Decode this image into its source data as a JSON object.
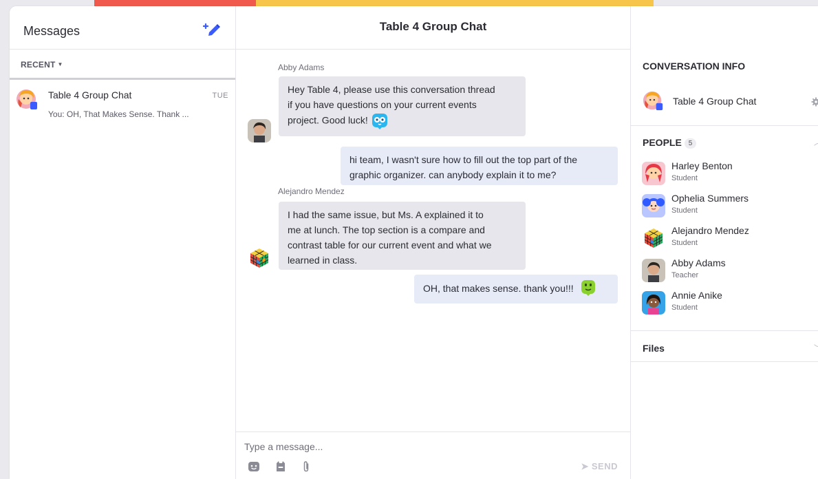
{
  "sidebar": {
    "title": "Messages",
    "recent_label": "RECENT",
    "conversations": [
      {
        "name": "Table 4 Group Chat",
        "day": "TUE",
        "preview": "You: OH, That Makes Sense. Thank ..."
      }
    ]
  },
  "chat": {
    "title": "Table 4 Group Chat",
    "messages": [
      {
        "sender": "Abby Adams",
        "lines": [
          "Hey Table 4, please use this conversation thread",
          "if you have questions on your current events",
          "project. Good luck!"
        ]
      },
      {
        "sender": "",
        "lines": [
          "hi team, I wasn't sure how to fill out the top part of the",
          "graphic organizer. can anybody explain it to me?"
        ]
      },
      {
        "sender": "Alejandro Mendez",
        "lines": [
          "I had the same issue, but Ms. A explained it to",
          "me at lunch. The top section is a compare and",
          "contrast table for our current event and what we",
          "learned in class."
        ]
      },
      {
        "sender": "",
        "lines": [
          "OH, that makes sense. thank you!!!"
        ]
      }
    ],
    "composer": {
      "placeholder": "Type a message...",
      "send_label": "SEND"
    }
  },
  "info": {
    "title": "CONVERSATION INFO",
    "conversation_name": "Table 4 Group Chat",
    "people_label": "PEOPLE",
    "people_count": "5",
    "people": [
      {
        "name": "Harley Benton",
        "role": "Student"
      },
      {
        "name": "Ophelia Summers",
        "role": "Student"
      },
      {
        "name": "Alejandro Mendez",
        "role": "Student"
      },
      {
        "name": "Abby Adams",
        "role": "Teacher"
      },
      {
        "name": "Annie Anike",
        "role": "Student"
      }
    ],
    "files_label": "Files"
  },
  "icons": {
    "compose": "compose-pencil-icon",
    "emoji": "emoji-icon",
    "sticker": "sticker-icon",
    "attach": "paperclip-icon",
    "send": "send-arrow-icon",
    "settings": "gear-icon"
  },
  "colors": {
    "accent_blue": "#3b5bfd",
    "bubble_incoming": "#e6e6ec",
    "bubble_outgoing": "#e6ebf7",
    "strip_red": "#ef5a4c",
    "strip_yellow": "#f6c54a"
  }
}
